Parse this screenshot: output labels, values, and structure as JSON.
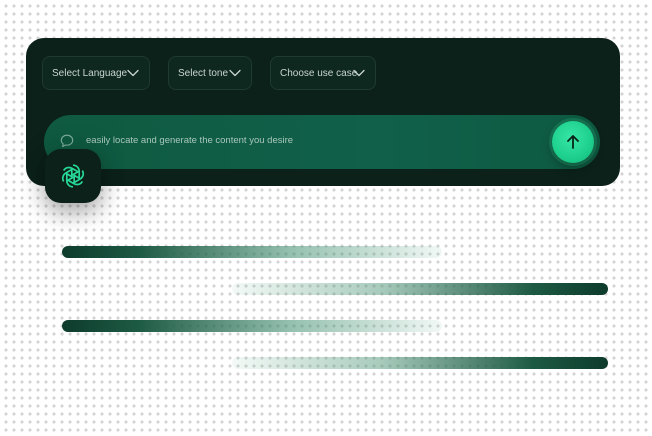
{
  "dropdowns": {
    "language": {
      "label": "Select Language",
      "icon": "chevron-down-icon"
    },
    "tone": {
      "label": "Select tone",
      "icon": "chevron-down-icon"
    },
    "use_case": {
      "label": "Choose use case",
      "icon": "chevron-down-icon"
    }
  },
  "prompt": {
    "text": "easily locate and generate the content you desire",
    "leading_icon": "chat-bubble-icon",
    "send_icon": "arrow-up-icon"
  },
  "badge": {
    "icon": "openai-logo-icon"
  },
  "colors": {
    "panel_bg": "#0b2119",
    "prompt_bg": "#10604a",
    "accent": "#1fd18e",
    "logo": "#27d998",
    "stripe_dark": "#0e3b2c"
  }
}
